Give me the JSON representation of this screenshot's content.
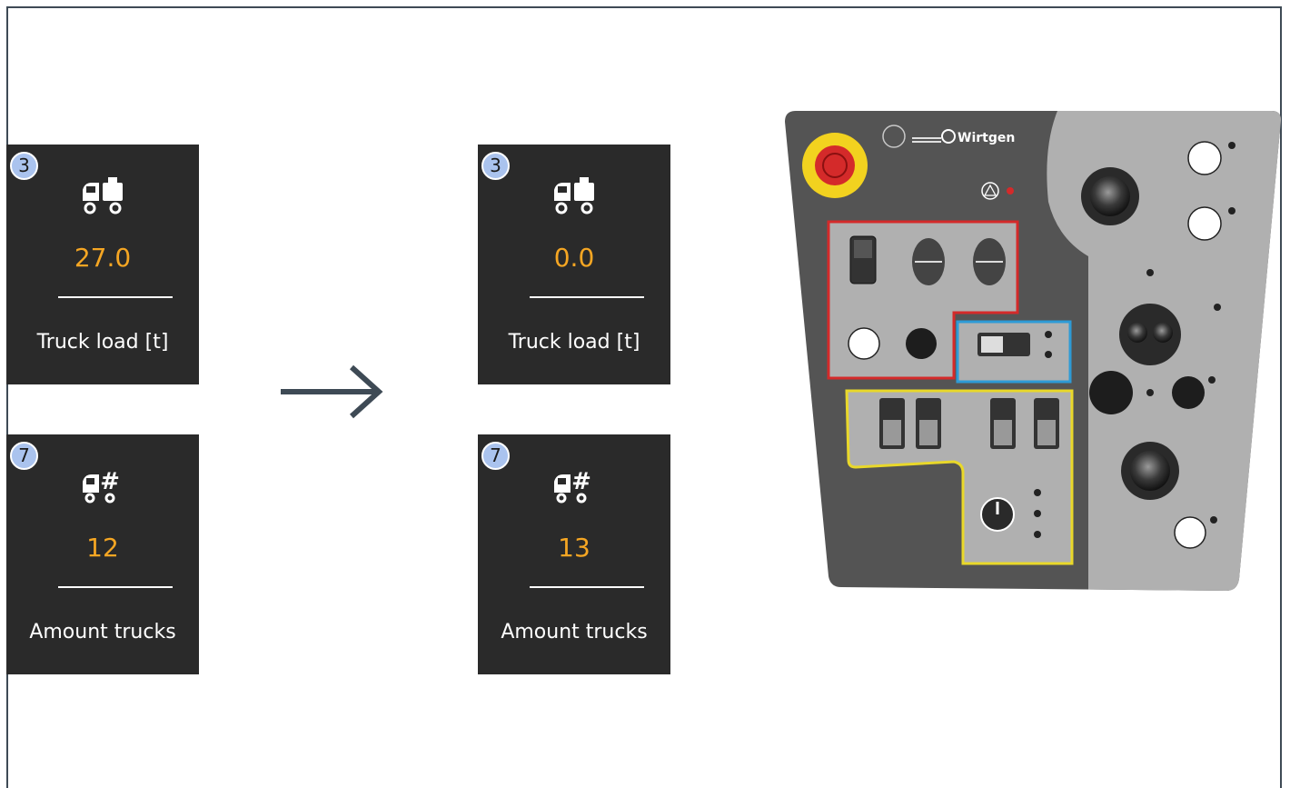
{
  "before": {
    "truck_load": {
      "badge": "3",
      "value": "27.0",
      "label": "Truck load [t]",
      "icon": "truck-load-icon"
    },
    "amount_trucks": {
      "badge": "7",
      "value": "12",
      "label": "Amount trucks",
      "icon": "truck-count-icon"
    }
  },
  "after": {
    "truck_load": {
      "badge": "3",
      "value": "0.0",
      "label": "Truck load [t]",
      "icon": "truck-load-icon"
    },
    "amount_trucks": {
      "badge": "7",
      "value": "13",
      "label": "Amount trucks",
      "icon": "truck-count-icon"
    }
  },
  "transition": {
    "icon": "right-arrow-icon"
  },
  "control_panel": {
    "brand": "Wirtgen",
    "emergency_stop": {
      "icon": "emergency-stop-icon"
    },
    "colors": {
      "panel_dark": "#545454",
      "panel_light": "#b0b0b0",
      "red_zone": "#d42a2a",
      "blue_zone": "#2e9bd6",
      "yellow_zone": "#e9d82a",
      "value": "#f5a623",
      "tile_bg": "#2a2a2a",
      "badge": "#aac3ee"
    }
  }
}
